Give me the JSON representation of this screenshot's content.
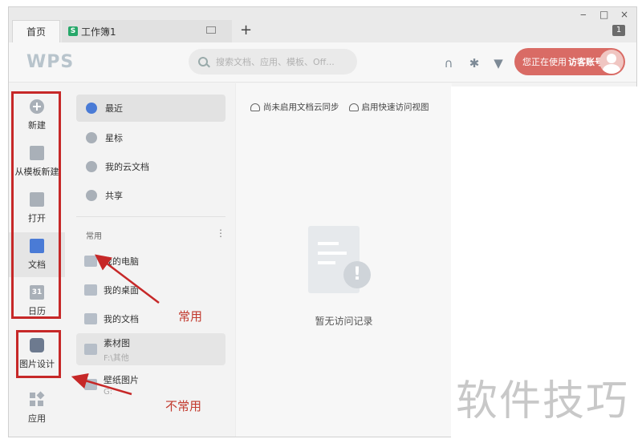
{
  "tabs": {
    "home_label": "首页",
    "workbook_label": "工作簿1",
    "workbook_icon": "S",
    "add_label": "+"
  },
  "window_controls": {
    "minimize": "‒",
    "maximize": "□",
    "close": "×",
    "badge": "1"
  },
  "header": {
    "logo": "WPS",
    "search_placeholder": "搜索文档、应用、模板、Off...",
    "guest_prefix": "您正在使用",
    "guest_bold": "访客账号"
  },
  "leftbar": {
    "items": [
      {
        "label": "新建",
        "icon": "plus-circle-icon"
      },
      {
        "label": "从模板新建",
        "icon": "template-icon"
      },
      {
        "label": "打开",
        "icon": "folder-icon"
      },
      {
        "label": "文档",
        "icon": "document-icon"
      },
      {
        "label": "日历",
        "icon": "calendar-icon",
        "glyph": "31"
      },
      {
        "label": "图片设计",
        "icon": "picture-icon"
      },
      {
        "label": "应用",
        "icon": "apps-icon"
      }
    ]
  },
  "nav": {
    "items": [
      {
        "label": "最近",
        "icon": "clock-icon"
      },
      {
        "label": "星标",
        "icon": "star-icon"
      },
      {
        "label": "我的云文档",
        "icon": "cloud-box-icon"
      },
      {
        "label": "共享",
        "icon": "people-icon"
      }
    ],
    "section_label": "常用",
    "more": "⋮",
    "files": [
      {
        "name": "我的电脑",
        "path": ""
      },
      {
        "name": "我的桌面",
        "path": ""
      },
      {
        "name": "我的文档",
        "path": ""
      },
      {
        "name": "素材图",
        "path": "F:\\其他"
      },
      {
        "name": "壁纸图片",
        "path": "G:"
      }
    ]
  },
  "main": {
    "toolbar": [
      "尚未启用文档云同步",
      "启用快速访问视图"
    ],
    "empty_text": "暂无访问记录"
  },
  "annotations": {
    "common": "常用",
    "uncommon": "不常用",
    "color": "#c62828"
  },
  "watermark": "软件技巧"
}
